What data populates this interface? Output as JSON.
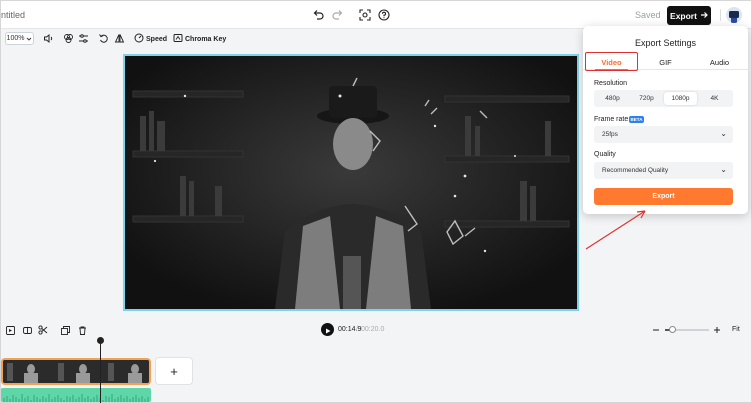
{
  "header": {
    "project_title": "ntitled",
    "saved_label": "Saved",
    "export_label": "Export"
  },
  "toolbar": {
    "zoom_value": "100%",
    "speed_label": "Speed",
    "chroma_label": "Chroma Key"
  },
  "timeline": {
    "current_time": "00:14.9",
    "separator": "/",
    "total_time": "00:20.0",
    "fit_label": "Fit",
    "add_label": "+",
    "zoom_level": 0.15
  },
  "export_settings": {
    "title": "Export Settings",
    "tabs": [
      "Video",
      "GIF",
      "Audio"
    ],
    "active_tab": "Video",
    "resolution_label": "Resolution",
    "resolutions": [
      "480p",
      "720p",
      "1080p",
      "4K"
    ],
    "selected_resolution": "1080p",
    "frame_rate_label": "Frame rate",
    "beta_badge": "BETA",
    "frame_rate_value": "25fps",
    "quality_label": "Quality",
    "quality_value": "Recommended Quality",
    "export_button": "Export"
  },
  "colors": {
    "accent": "#ff7a2f",
    "annotation": "#e03030",
    "preview_border": "#7fd3e6",
    "clip_border": "#f0a356",
    "audio_track": "#5fd6a8"
  }
}
